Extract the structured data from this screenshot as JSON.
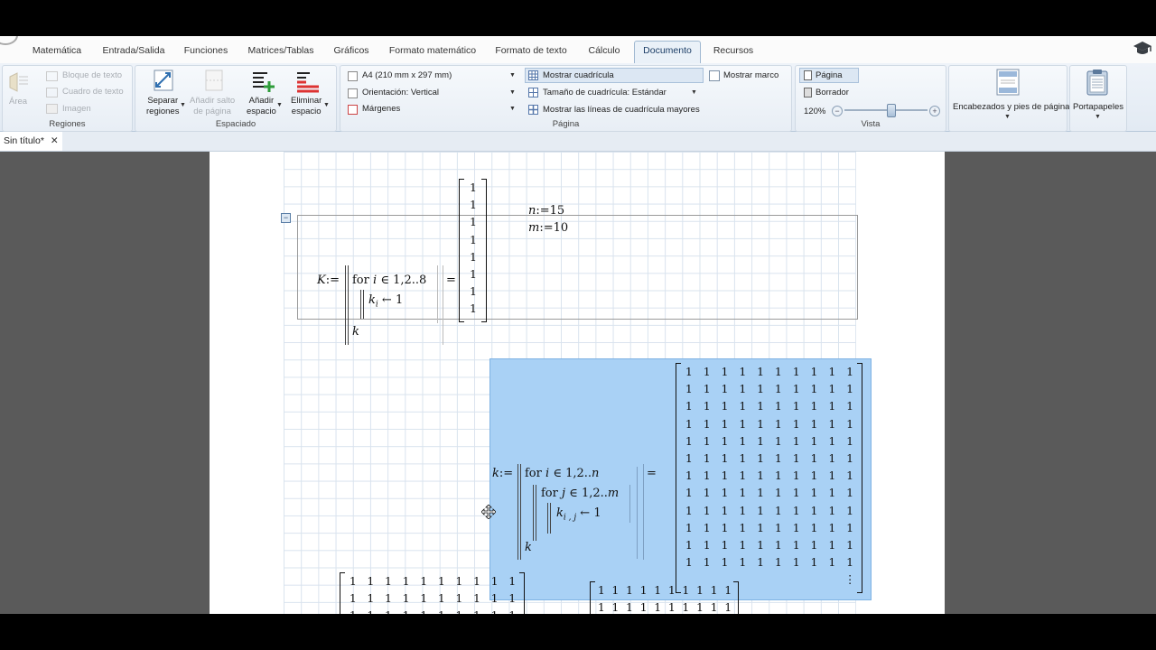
{
  "tabs": [
    {
      "label": "Matemática",
      "active": false
    },
    {
      "label": "Entrada/Salida",
      "active": false
    },
    {
      "label": "Funciones",
      "active": false
    },
    {
      "label": "Matrices/Tablas",
      "active": false
    },
    {
      "label": "Gráficos",
      "active": false
    },
    {
      "label": "Formato matemático",
      "active": false
    },
    {
      "label": "Formato de texto",
      "active": false
    },
    {
      "label": "Cálculo",
      "active": false
    },
    {
      "label": "Documento",
      "active": true
    },
    {
      "label": "Recursos",
      "active": false
    }
  ],
  "ribbon": {
    "regiones": {
      "label": "Regiones",
      "area": "Área",
      "bloque": "Bloque de texto",
      "cuadro": "Cuadro de texto",
      "imagen": "Imagen"
    },
    "espaciado": {
      "label": "Espaciado",
      "separar": [
        "Separar",
        "regiones"
      ],
      "salto": [
        "Añadir salto",
        "de página"
      ],
      "anadir": [
        "Añadir",
        "espacio"
      ],
      "eliminar": [
        "Eliminar",
        "espacio"
      ]
    },
    "pagina": {
      "label": "Página",
      "size": "A4 (210 mm x 297 mm)",
      "orient": "Orientación:  Vertical",
      "margenes": "Márgenes",
      "cuadricula": "Mostrar cuadrícula",
      "tamano": "Tamaño de cuadrícula:  Estándar",
      "lineas": "Mostrar las líneas de cuadrícula mayores",
      "marco": "Mostrar marco"
    },
    "vista": {
      "label": "Vista",
      "pagina": "Página",
      "borrador": "Borrador",
      "zoom": "120%",
      "zoom_level": 0.55
    },
    "encabezados": "Encabezados y pies de página",
    "portapapeles": "Portapapeles"
  },
  "document_tab": "Sin título*",
  "worksheet": {
    "n_def": {
      "var": "n",
      "assign": ":=",
      "value": "15"
    },
    "m_def": {
      "var": "m",
      "assign": ":=",
      "value": "10"
    },
    "K_prog": {
      "lhs": "K",
      "assign": ":=",
      "for_kw": "for",
      "for_var": "i",
      "in": "∈",
      "range": "1,2..8",
      "body_var": "k",
      "body_sub": "i",
      "arrow": "←",
      "body_val": "1",
      "ret": "k",
      "eq": "=",
      "result": [
        "1",
        "1",
        "1",
        "1",
        "1",
        "1",
        "1",
        "1"
      ]
    },
    "k_prog": {
      "lhs": "k",
      "assign": ":=",
      "for_kw": "for",
      "outer_var": "i",
      "in": "∈",
      "outer_range": "1,2..",
      "outer_end": "n",
      "inner_var": "j",
      "inner_range": "1,2..",
      "inner_end": "m",
      "body_var": "k",
      "body_sub": "i , j",
      "arrow": "←",
      "body_val": "1",
      "ret": "k",
      "eq": "=",
      "ellipsis": "⋮",
      "result_rows": 12,
      "result_cols": 10,
      "cell": "1"
    },
    "partial_left": {
      "rows": 5,
      "cols": 10,
      "cell": "1"
    },
    "partial_right": {
      "rows": 4,
      "cols": 10,
      "cell": "1"
    }
  },
  "colors": {
    "selection": "#a9d1f5",
    "accent": "#1b3d66"
  }
}
